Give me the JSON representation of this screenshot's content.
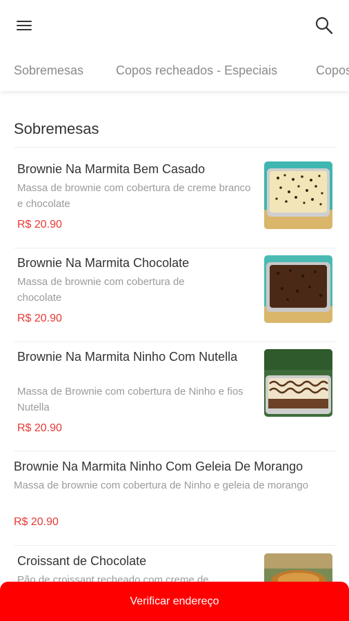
{
  "header": {
    "menu_icon": "menu-icon",
    "search_icon": "search-icon"
  },
  "tabs": [
    {
      "label": "Sobremesas"
    },
    {
      "label": "Copos recheados - Especiais"
    },
    {
      "label": "Copos"
    }
  ],
  "section": {
    "title": "Sobremesas"
  },
  "items": [
    {
      "name": "Brownie Na Marmita Bem Casado",
      "description": "Massa de brownie com cobertura de creme branco e chocolate",
      "price": "R$ 20.90"
    },
    {
      "name": "Brownie Na Marmita Chocolate",
      "description": "Massa de brownie com cobertura de chocolate",
      "price": "R$ 20.90"
    },
    {
      "name": "Brownie Na Marmita Ninho Com Nutella",
      "description": "Massa de Brownie com cobertura de Ninho e fios Nutella",
      "price": "R$ 20.90"
    },
    {
      "name": "Brownie Na Marmita Ninho Com Geleia De Morango",
      "description": "Massa de brownie com cobertura de Ninho e geleia de morango",
      "price": "R$ 20.90"
    },
    {
      "name": "Croissant de Chocolate",
      "description": "Pão de croissant recheado com creme de"
    }
  ],
  "footer": {
    "button_label": "Verificar endereço"
  },
  "colors": {
    "accent": "#ff0000",
    "price": "#e53935"
  }
}
